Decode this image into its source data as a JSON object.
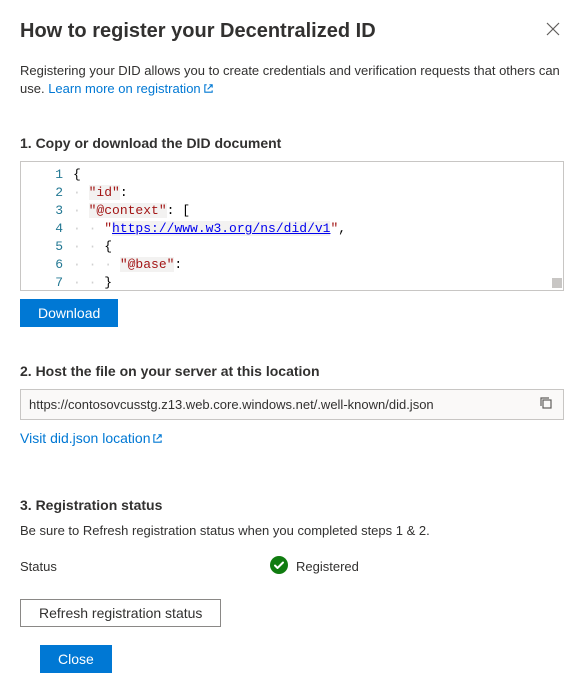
{
  "header": {
    "title": "How to register your Decentralized ID"
  },
  "intro": {
    "text_before": "Registering your DID allows you to create credentials and verification requests that others can use. ",
    "link_text": "Learn more on registration"
  },
  "step1": {
    "heading": "1. Copy or download the DID document",
    "download_label": "Download",
    "code": {
      "line_numbers": [
        "1",
        "2",
        "3",
        "4",
        "5",
        "6",
        "7"
      ],
      "key_id": "\"id\"",
      "key_context": "\"@context\"",
      "url": "https://www.w3.org/ns/did/v1",
      "key_base": "\"@base\""
    }
  },
  "step2": {
    "heading": "2. Host the file on your server at this location",
    "url": "https://contosovcusstg.z13.web.core.windows.net/.well-known/did.json",
    "visit_link": "Visit did.json location"
  },
  "step3": {
    "heading": "3. Registration status",
    "description": "Be sure to Refresh registration status when you completed steps 1 & 2.",
    "status_label": "Status",
    "status_value": "Registered",
    "refresh_label": "Refresh registration status"
  },
  "footer": {
    "close_label": "Close"
  }
}
